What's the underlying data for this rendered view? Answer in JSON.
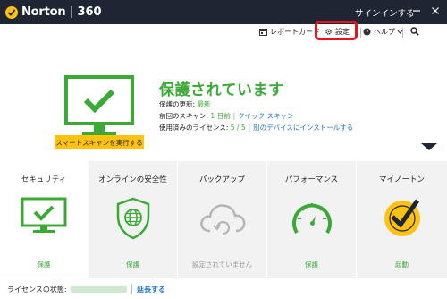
{
  "titlebar": {
    "brand_name": "Norton",
    "brand_version": "360",
    "signin_label": "サインインする"
  },
  "toolbar": {
    "report_card_label": "レポートカード",
    "settings_label": "設定",
    "help_label": "ヘルプ"
  },
  "hero": {
    "status_title": "保護されています",
    "update_label": "保護の更新:",
    "update_value": "最新",
    "last_scan_label": "前回のスキャン:",
    "last_scan_value": "1 日前",
    "quick_scan_link": "クイック スキャン",
    "license_label": "使用済みのライセンス:",
    "license_value": "5 / 5",
    "install_link": "別のデバイスにインストールする",
    "smart_scan_button": "スマートスキャンを実行する"
  },
  "tiles": [
    {
      "title": "セキュリティ",
      "status": "保護",
      "icon": "monitor-check-icon"
    },
    {
      "title": "オンラインの安全性",
      "status": "保護",
      "icon": "shield-globe-icon"
    },
    {
      "title": "バックアップ",
      "status": "設定されていません",
      "icon": "cloud-sync-icon"
    },
    {
      "title": "パフォーマンス",
      "status": "保護",
      "icon": "speedometer-icon"
    },
    {
      "title": "マイノートン",
      "status": "起動",
      "icon": "norton-check-icon"
    }
  ],
  "footer": {
    "license_status_label": "ライセンスの状態:",
    "extend_link": "延長する"
  },
  "colors": {
    "titlebar_bg": "#1f2532",
    "protected_green": "#3aaa35",
    "accent_yellow": "#ffc20e",
    "link_blue": "#1a73c7",
    "highlight_red": "#e3141b"
  }
}
